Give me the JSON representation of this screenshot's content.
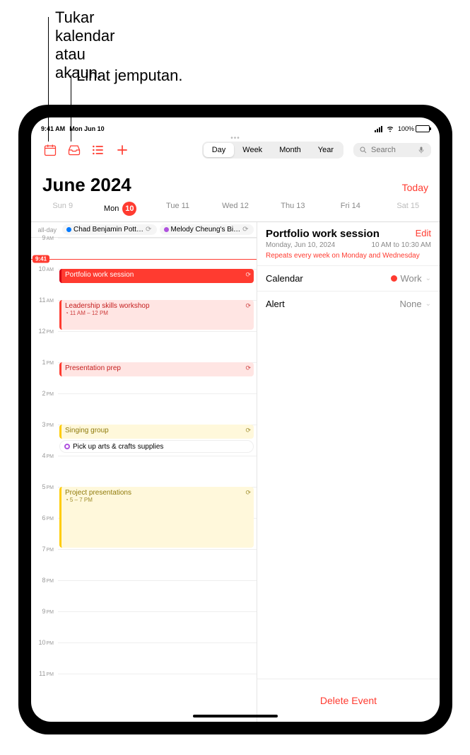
{
  "annotations": {
    "ann1": "Tukar kalendar\natau akaun.",
    "ann2": "Lihat jemputan."
  },
  "status": {
    "time": "9:41 AM",
    "date": "Mon Jun 10",
    "battery": "100%"
  },
  "views": {
    "day": "Day",
    "week": "Week",
    "month": "Month",
    "year": "Year"
  },
  "search": {
    "placeholder": "Search"
  },
  "header": {
    "month": "June 2024",
    "today": "Today"
  },
  "days": [
    {
      "label": "Sun 9",
      "weekend": true
    },
    {
      "label": "Mon",
      "num": "10",
      "today": true
    },
    {
      "label": "Tue 11"
    },
    {
      "label": "Wed 12"
    },
    {
      "label": "Thu 13"
    },
    {
      "label": "Fri 14"
    },
    {
      "label": "Sat 15",
      "weekend": true
    }
  ],
  "allday": {
    "label": "all-day",
    "pill1": "Chad Benjamin Pott…",
    "pill2": "Melody Cheung's Bi…"
  },
  "hours": [
    "9",
    "10",
    "11",
    "12",
    "1",
    "2",
    "3",
    "4",
    "5",
    "6",
    "7",
    "8",
    "9",
    "10",
    "11"
  ],
  "ampm": [
    "AM",
    "AM",
    "AM",
    "PM",
    "PM",
    "PM",
    "PM",
    "PM",
    "PM",
    "PM",
    "PM",
    "PM",
    "PM",
    "PM",
    "PM"
  ],
  "now": "9:41",
  "events": {
    "e1": {
      "title": "Portfolio work session"
    },
    "e2": {
      "title": "Leadership skills workshop",
      "sub": "11 AM – 12 PM"
    },
    "e3": {
      "title": "Presentation prep"
    },
    "e4": {
      "title": "Singing group"
    },
    "e5": {
      "title": "Pick up arts & crafts supplies"
    },
    "e6": {
      "title": "Project presentations",
      "sub": "5 – 7 PM"
    }
  },
  "detail": {
    "title": "Portfolio work session",
    "edit": "Edit",
    "date": "Monday, Jun 10, 2024",
    "time": "10 AM to 10:30 AM",
    "repeat": "Repeats every week on Monday and Wednesday",
    "cal_label": "Calendar",
    "cal_value": "Work",
    "alert_label": "Alert",
    "alert_value": "None",
    "delete": "Delete Event"
  }
}
